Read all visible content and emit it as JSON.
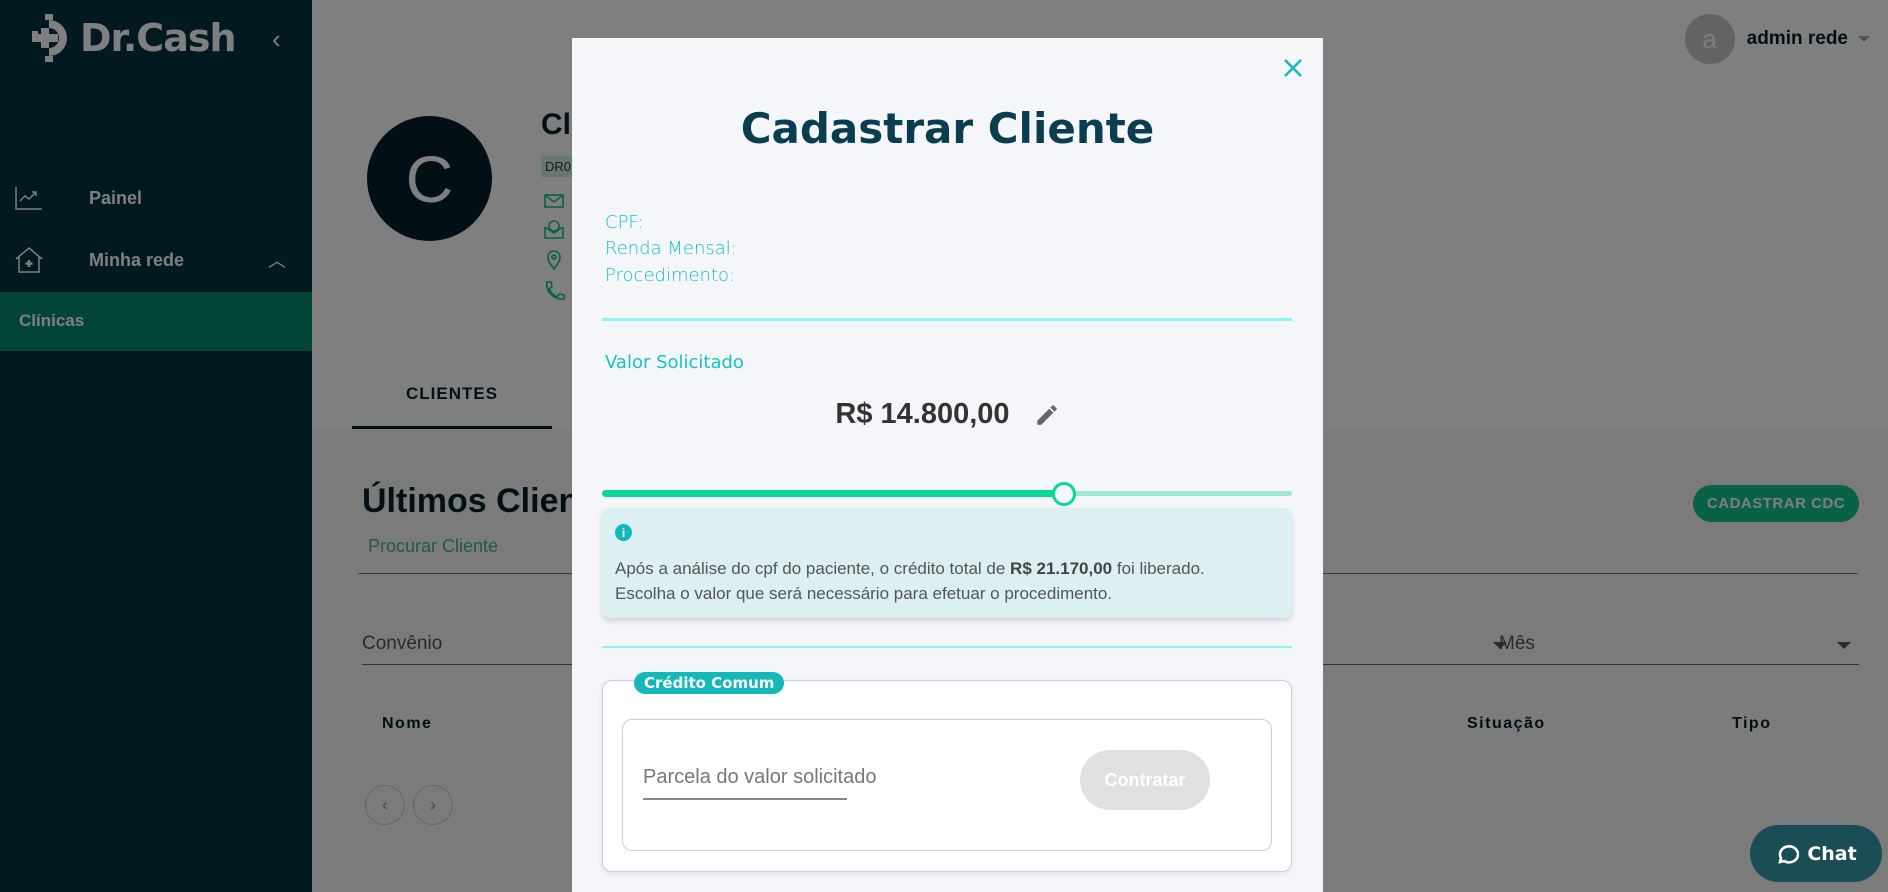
{
  "sidebar": {
    "brand": "Dr.Cash",
    "collapse_icon": "chevron-left-icon",
    "items": [
      {
        "label": "Painel",
        "icon": "chart-trend-icon"
      },
      {
        "label": "Minha rede",
        "icon": "house-plus-icon",
        "expanded": true
      }
    ],
    "sub_items": [
      {
        "label": "Clínicas",
        "active": true
      }
    ]
  },
  "header": {
    "user_initial": "a",
    "user_name": "admin rede"
  },
  "profile": {
    "avatar_initial": "C",
    "name_visible": "Cl",
    "code_visible": "DR0",
    "icons": [
      "mail-icon",
      "money-envelope-icon",
      "location-pin-icon",
      "phone-icon"
    ]
  },
  "tabs": [
    {
      "label": "CLIENTES",
      "active": true
    }
  ],
  "clients_section": {
    "title": "Últimos Clientes",
    "search_placeholder": "Procurar Cliente",
    "cdc_button": "CADASTRAR CDC",
    "filters": [
      {
        "placeholder": "Convênio"
      },
      {
        "placeholder": ""
      },
      {
        "placeholder": "Mês"
      }
    ],
    "columns": [
      "Nome",
      "Situação",
      "Tipo"
    ],
    "pager": {
      "prev": "‹",
      "next": "›"
    }
  },
  "chat": {
    "label": "Chat"
  },
  "modal": {
    "title": "Cadastrar Cliente",
    "close": "×",
    "fields": {
      "cpf": "CPF:",
      "renda": "Renda Mensal:",
      "procedimento": "Procedimento:"
    },
    "valor_label": "Valor Solicitado",
    "valor_amount": "R$ 14.800,00",
    "slider": {
      "value_fraction": 0.67
    },
    "info": {
      "icon": "i",
      "text_before": "Após a análise do cpf do paciente, o crédito total de ",
      "credit_total": "R$ 21.170,00",
      "text_after": " foi liberado.",
      "line2": "Escolha o valor que será necessário para efetuar o procedimento."
    },
    "credit_card": {
      "tag": "Crédito Comum",
      "parcela_placeholder": "Parcela do valor solicitado",
      "contratar": "Contratar"
    }
  },
  "colors": {
    "sidebar_bg": "#05353f",
    "sidebar_active": "#058a71",
    "accent_teal": "#17c2c2",
    "slider_green": "#0dd498",
    "cdc_green": "#13c28e",
    "title_dark": "#0a3d4f",
    "chat_bg": "#1a4d55"
  }
}
